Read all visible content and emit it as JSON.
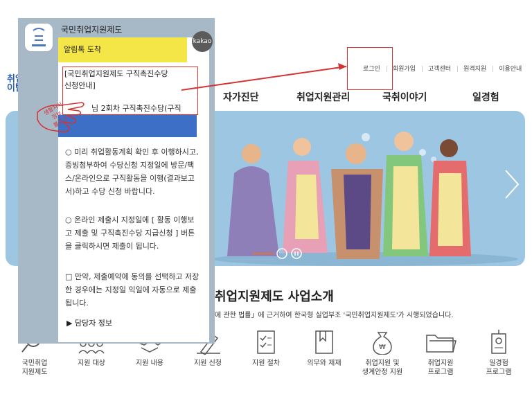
{
  "top_nav": [
    "로그인",
    "회원가입",
    "고객센터",
    "원격지원",
    "이용안내"
  ],
  "logo_text": "취업\n이탐",
  "main_nav": [
    "자가진단",
    "취업지원관리",
    "국취이야기",
    "일경험"
  ],
  "section_title": "취업지원제도 사업소개",
  "section_desc": "에 관한 법률」에 근거하여 한국형 실업부조 '국민취업지원제도'가 시행되었습니다.",
  "icons": [
    {
      "label": "국민취업\n지원제도",
      "icon": "magnifier-icon"
    },
    {
      "label": "지원 대상",
      "icon": "people-icon"
    },
    {
      "label": "지원 내용",
      "icon": "handshake-icon"
    },
    {
      "label": "지원 신청",
      "icon": "pencil-icon"
    },
    {
      "label": "지원 절차",
      "icon": "checklist-icon"
    },
    {
      "label": "의무와 제재",
      "icon": "book-icon"
    },
    {
      "label": "취업지원 및\n생계안정 지원",
      "icon": "money-bag-icon"
    },
    {
      "label": "취업지원\n프로그램",
      "icon": "folder-icon"
    },
    {
      "label": "일경험\n프로그램",
      "icon": "id-badge-icon"
    }
  ],
  "kakao": {
    "sender": "국민취업지원제도",
    "header": "알림톡 도착",
    "badge": "kakao",
    "title_lines": [
      "[국민취업지원제도 구직촉진수당",
      "신청안내]"
    ],
    "partial_line": "님 2회차 구직촉진수당(구직",
    "paragraphs": [
      "○ 미리 취업활동계획 확인 후 이행하시고, 증빙첨부하여 수당신청 지정일에 방문/팩스/온라인으로  구직활동을 이행(결과보고서)하고 수당 신청 바랍니다.",
      "○ 온라인 제출시 지정일에 [ 활동 이행보고 제출 및 구직촉진수당 지급신청 ] 버튼을 클릭하시면 제출이 됩니다.",
      "□ 만약, 제출예약에 동의를 선택하고 저장한 경우에는 지정일 익일에 자동으로 제출됩니다."
    ],
    "contact": "▶ 담당자 정보"
  },
  "sign_text": [
    "생활지식",
    "정보",
    "블로그"
  ],
  "colors": {
    "banner": "#9dc6e3",
    "kakao_yellow": "#f4e646",
    "blue_bar": "#3e6fc6",
    "red": "#d33333"
  }
}
